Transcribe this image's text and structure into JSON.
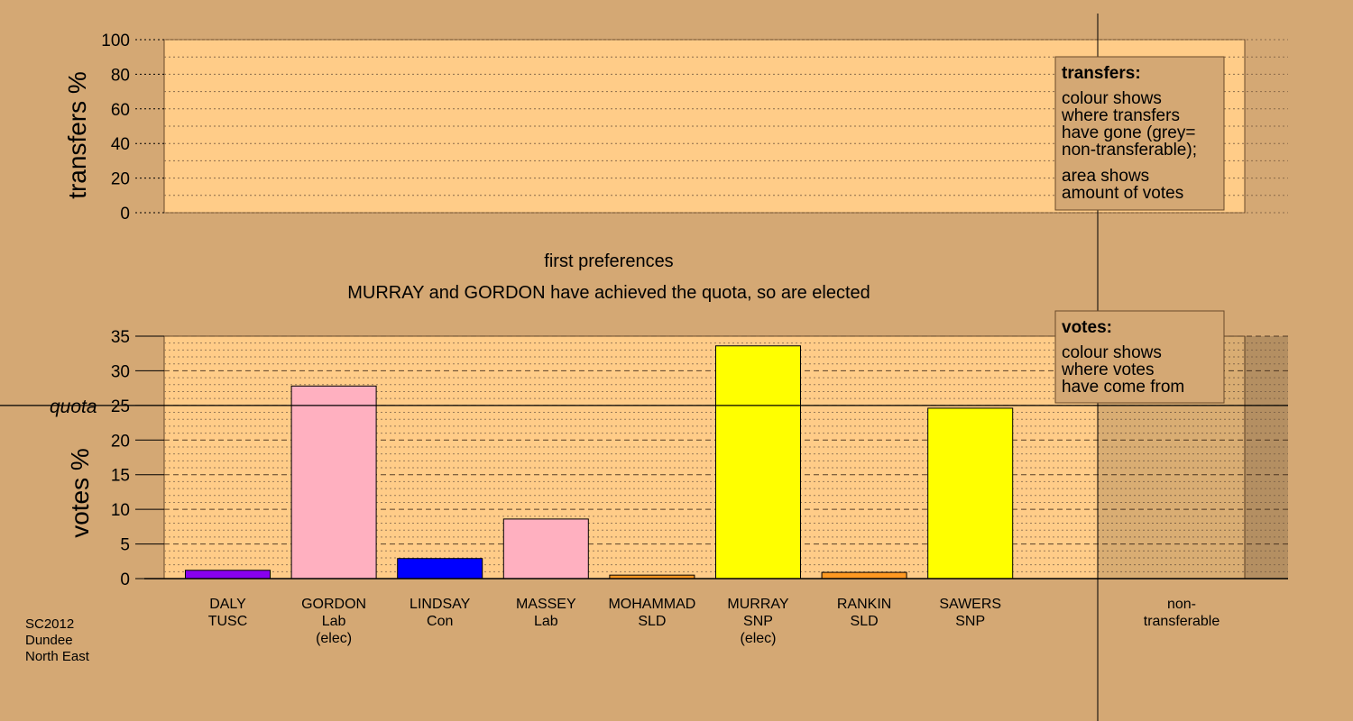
{
  "chart_data": [
    {
      "type": "bar",
      "ylabel": "transfers %",
      "ylim": [
        0,
        100
      ],
      "yticks": [
        0,
        20,
        40,
        60,
        80,
        100
      ],
      "grid": true,
      "values": []
    },
    {
      "type": "bar",
      "ylabel": "votes %",
      "ylim": [
        0,
        35
      ],
      "yticks": [
        0,
        5,
        10,
        15,
        20,
        25,
        30,
        35
      ],
      "quota": 25,
      "quota_label": "quota",
      "grid": true,
      "categories": [
        [
          "DALY",
          "TUSC"
        ],
        [
          "GORDON",
          "Lab",
          "(elec)"
        ],
        [
          "LINDSAY",
          "Con"
        ],
        [
          "MASSEY",
          "Lab"
        ],
        [
          "MOHAMMAD",
          "SLD"
        ],
        [
          "MURRAY",
          "SNP",
          "(elec)"
        ],
        [
          "RANKIN",
          "SLD"
        ],
        [
          "SAWERS",
          "SNP"
        ]
      ],
      "values": [
        1.2,
        27.8,
        2.9,
        8.6,
        0.5,
        33.6,
        0.9,
        24.6
      ],
      "colors": [
        "#8800ee",
        "#ffb0c0",
        "#0000ff",
        "#ffb0c0",
        "#ff9922",
        "#ffff00",
        "#ff9922",
        "#ffff00"
      ],
      "nontransferable_label": [
        "non-",
        "transferable"
      ]
    }
  ],
  "annotations": {
    "first_preferences": "first preferences",
    "status": "MURRAY and GORDON have achieved the quota, so are elected"
  },
  "legend_transfers": {
    "title": "transfers:",
    "para1": [
      "colour shows",
      "where transfers",
      "have gone (grey=",
      "non-transferable);"
    ],
    "para2": [
      "area shows",
      "amount of votes"
    ]
  },
  "legend_votes": {
    "title": "votes:",
    "para1": [
      "colour shows",
      "where votes",
      "have come from"
    ]
  },
  "footer": [
    "SC2012",
    "Dundee",
    "North East"
  ],
  "colors": {
    "background": "#d4a874",
    "plot_fill": "#ffcc88"
  }
}
